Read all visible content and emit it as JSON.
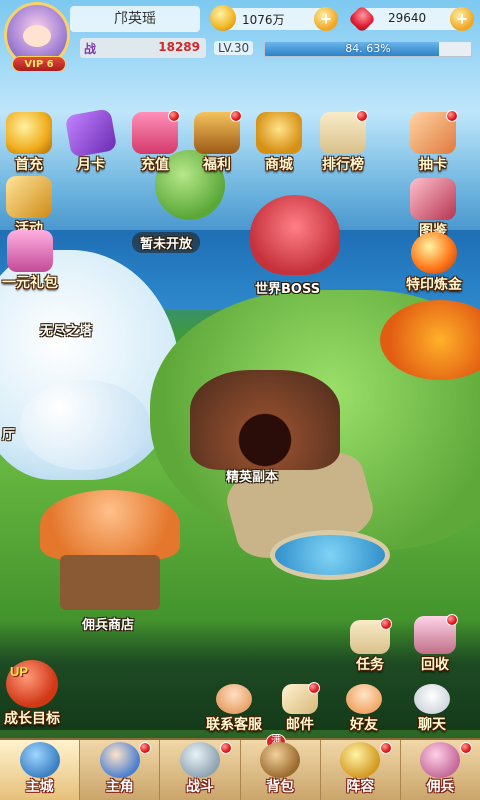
{
  "player": {
    "name": "邝英瑶",
    "vip": "VIP 6",
    "power_label": "战",
    "power": "18289",
    "level": "LV.30",
    "exp_percent_text": "84. 63%",
    "exp_fraction": 0.8463
  },
  "resources": {
    "gold": "1076万",
    "gems": "29640"
  },
  "features": {
    "first_recharge": "首充",
    "monthly_card": "月卡",
    "recharge": "充值",
    "welfare": "福利",
    "shop": "商城",
    "leaderboard": "排行榜",
    "draw": "抽卡",
    "events": "活动",
    "gallery": "图鉴",
    "one_yuan_gift": "一元礼包",
    "world_boss": "世界BOSS",
    "coming_soon": "暂未开放",
    "endless_tower": "无尽之塔",
    "hall": "厅",
    "special_seal": "特印炼金",
    "elite_dungeon": "精英副本",
    "mercenary_shop": "佣兵商店",
    "quest": "任务",
    "recycle": "回收",
    "growth_goal": "成长目标",
    "growth_up": "UP",
    "customer_service": "联系客服",
    "mail": "邮件",
    "friends": "好友",
    "chat": "聊天"
  },
  "nav": {
    "tabs": [
      {
        "label": "主城"
      },
      {
        "label": "主角"
      },
      {
        "label": "战斗"
      },
      {
        "label": "背包",
        "badge": "满"
      },
      {
        "label": "阵容"
      },
      {
        "label": "佣兵"
      }
    ]
  },
  "colors": {
    "accent_red": "#e01414",
    "gold": "#f0ad1e",
    "exp_fill": "#2e82c8"
  }
}
